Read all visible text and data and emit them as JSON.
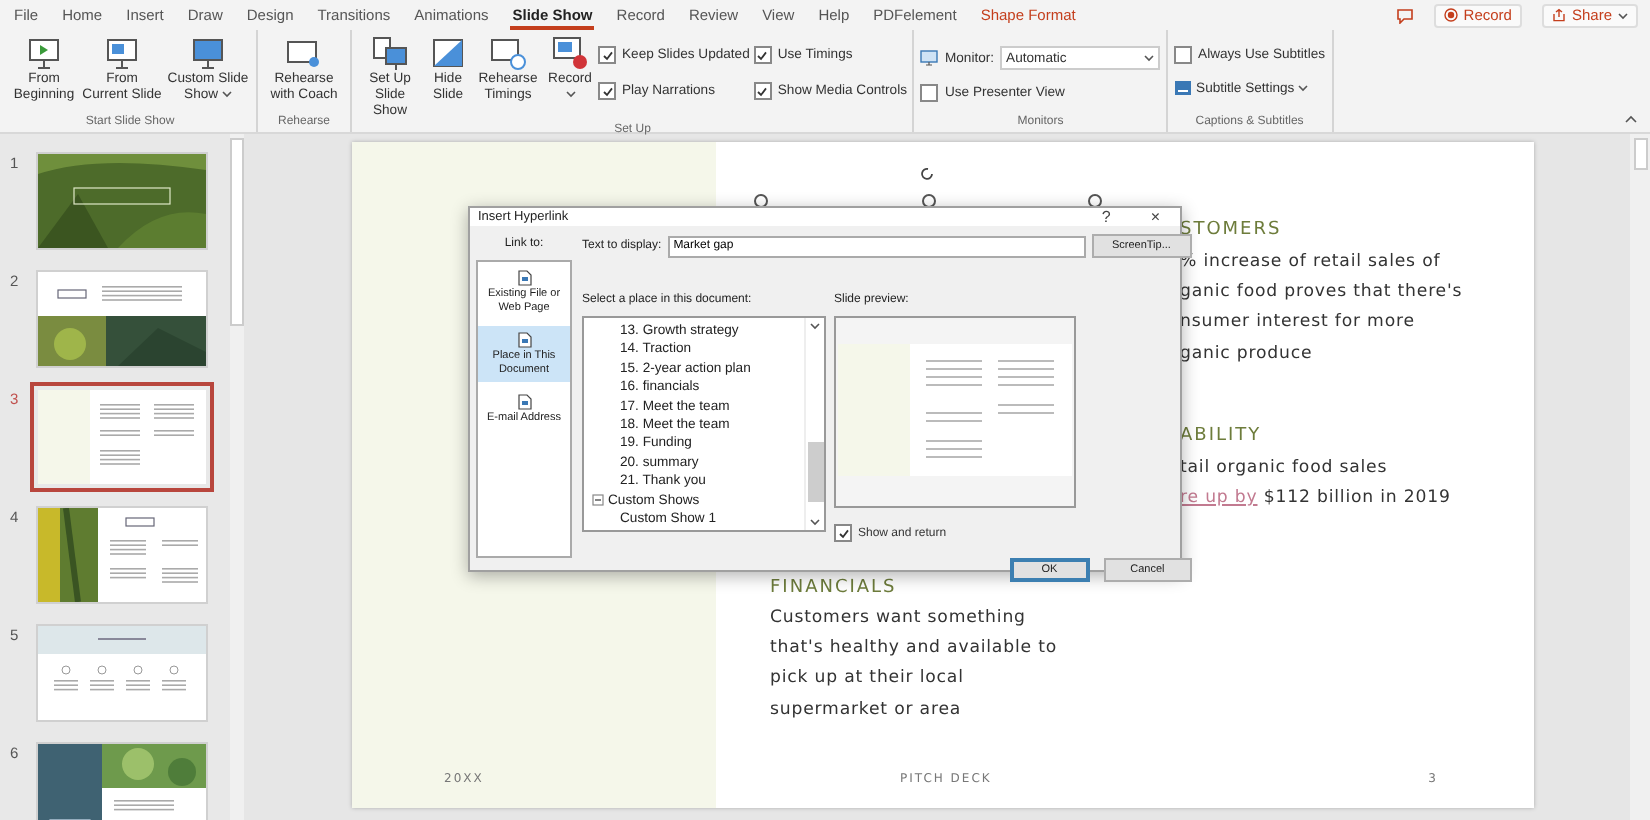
{
  "ribbon_tabs": [
    {
      "label": "File",
      "selected": false,
      "contextual": false
    },
    {
      "label": "Home",
      "selected": false,
      "contextual": false
    },
    {
      "label": "Insert",
      "selected": false,
      "contextual": false
    },
    {
      "label": "Draw",
      "selected": false,
      "contextual": false
    },
    {
      "label": "Design",
      "selected": false,
      "contextual": false
    },
    {
      "label": "Transitions",
      "selected": false,
      "contextual": false
    },
    {
      "label": "Animations",
      "selected": false,
      "contextual": false
    },
    {
      "label": "Slide Show",
      "selected": true,
      "contextual": false
    },
    {
      "label": "Record",
      "selected": false,
      "contextual": false
    },
    {
      "label": "Review",
      "selected": false,
      "contextual": false
    },
    {
      "label": "View",
      "selected": false,
      "contextual": false
    },
    {
      "label": "Help",
      "selected": false,
      "contextual": false
    },
    {
      "label": "PDFelement",
      "selected": false,
      "contextual": false
    },
    {
      "label": "Shape Format",
      "selected": false,
      "contextual": true
    }
  ],
  "title_actions": {
    "record": "Record",
    "share": "Share"
  },
  "start_slide_show": {
    "label": "Start Slide Show",
    "buttons": [
      {
        "label": "From Beginning",
        "dropdown": false
      },
      {
        "label": "From Current Slide",
        "dropdown": false
      },
      {
        "label": "Custom Slide Show",
        "dropdown": true
      }
    ]
  },
  "rehearse": {
    "label": "Rehearse",
    "buttons": [
      {
        "label": "Rehearse with Coach",
        "dropdown": false
      }
    ]
  },
  "set_up": {
    "label": "Set Up",
    "buttons": [
      {
        "label": "Set Up Slide Show",
        "dropdown": false
      },
      {
        "label": "Hide Slide",
        "dropdown": false
      },
      {
        "label": "Rehearse Timings",
        "dropdown": false
      },
      {
        "label": "Record",
        "dropdown": true
      }
    ],
    "checkboxes": [
      {
        "label": "Keep Slides Updated",
        "checked": true
      },
      {
        "label": "Play Narrations",
        "checked": true
      },
      {
        "label": "Use Timings",
        "checked": true
      },
      {
        "label": "Show Media Controls",
        "checked": true
      }
    ]
  },
  "monitors": {
    "label": "Monitors",
    "monitor_label": "Monitor:",
    "monitor_value": "Automatic",
    "presenter_view": {
      "label": "Use Presenter View",
      "checked": false
    }
  },
  "captions": {
    "label": "Captions & Subtitles",
    "always_subtitles": {
      "label": "Always Use Subtitles",
      "checked": false
    },
    "subtitle_settings": "Subtitle Settings"
  },
  "slides": [
    {
      "number": "1",
      "selected": false,
      "kind": "photo-title"
    },
    {
      "number": "2",
      "selected": false,
      "kind": "photo-split"
    },
    {
      "number": "3",
      "selected": true,
      "kind": "text-columns"
    },
    {
      "number": "4",
      "selected": false,
      "kind": "photo-left"
    },
    {
      "number": "5",
      "selected": false,
      "kind": "banner"
    },
    {
      "number": "6",
      "selected": false,
      "kind": "photo-card"
    }
  ],
  "slide": {
    "customers": {
      "heading": "STOMERS",
      "lines": [
        "% increase of retail sales of",
        "ganic food proves that there's",
        "nsumer interest for more",
        "ganic produce"
      ]
    },
    "scalability": {
      "heading": "ABILITY",
      "lines": [
        "tail organic food sales"
      ],
      "link": "re up by",
      "after_link": "$112 billion in 2019"
    },
    "financials": {
      "heading": "FINANCIALS",
      "body": "Customers want something that's healthy and available to pick up at their local supermarket or area"
    },
    "footer": {
      "year": "20XX",
      "title": "PITCH DECK",
      "page": "3"
    }
  },
  "dialog": {
    "title": "Insert Hyperlink",
    "help": "?",
    "close": "×",
    "link_to_label": "Link to:",
    "link_targets": [
      {
        "label": "Existing File or Web Page",
        "selected": false
      },
      {
        "label": "Place in This Document",
        "selected": true
      },
      {
        "label": "E-mail Address",
        "selected": false
      }
    ],
    "text_to_display_label": "Text to display:",
    "text_to_display": "Market gap",
    "screentip": "ScreenTip...",
    "place_label": "Select a place in this document:",
    "slide_titles": [
      "13. Growth strategy",
      "14. Traction",
      "15. 2-year action plan",
      "16. financials",
      "17. Meet the team",
      "18. Meet the team",
      "19. Funding",
      "20. summary",
      "21. Thank you"
    ],
    "custom_shows": {
      "label": "Custom Shows",
      "expanded": true,
      "children": [
        "Custom Show 1"
      ]
    },
    "preview_label": "Slide preview:",
    "show_and_return": {
      "label": "Show and return",
      "checked": true
    },
    "ok": "OK",
    "cancel": "Cancel"
  }
}
